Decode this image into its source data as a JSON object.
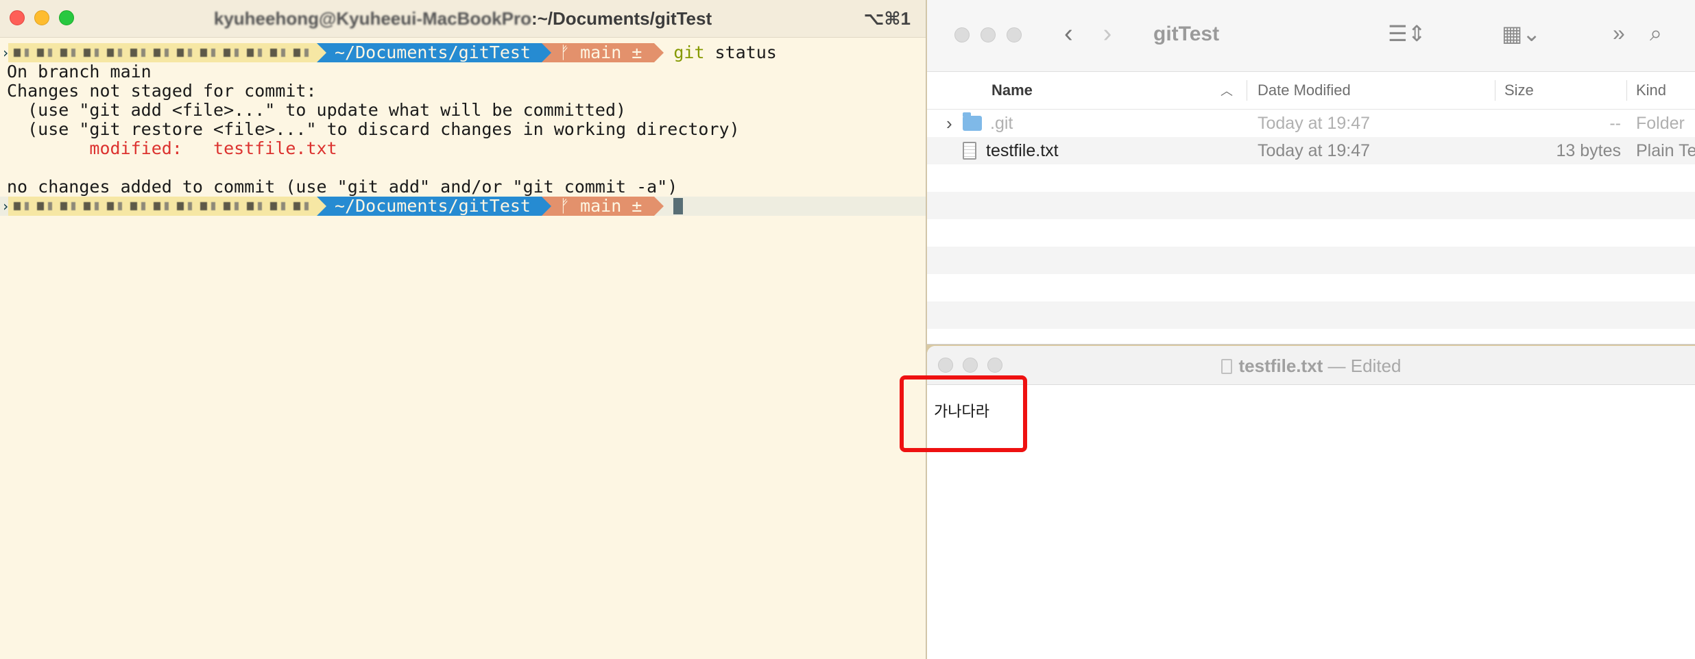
{
  "terminal": {
    "title_user": "kyuheehong@Kyuheeui-MacBookPro",
    "title_path": "~/Documents/gitTest",
    "shortcut": "⌥⌘1",
    "prompt_path": "~/Documents/gitTest",
    "prompt_branch": "ᚠ main ±",
    "command_git": "git",
    "command_args": " status",
    "output": [
      "On branch main",
      "Changes not staged for commit:",
      "  (use \"git add <file>...\" to update what will be committed)",
      "  (use \"git restore <file>...\" to discard changes in working directory)"
    ],
    "modified_label": "        modified:   testfile.txt",
    "no_changes": "no changes added to commit (use \"git add\" and/or \"git commit -a\")"
  },
  "finder": {
    "title": "gitTest",
    "columns": {
      "name": "Name",
      "date": "Date Modified",
      "size": "Size",
      "kind": "Kind"
    },
    "rows": [
      {
        "name": ".git",
        "date": "Today at 19:47",
        "size": "--",
        "kind": "Folder"
      },
      {
        "name": "testfile.txt",
        "date": "Today at 19:47",
        "size": "13 bytes",
        "kind": "Plain Te"
      }
    ]
  },
  "textedit": {
    "filename": "testfile.txt",
    "separator": " — ",
    "status": "Edited",
    "content": "가나다라"
  },
  "colors": {
    "terminal_bg": "#fdf6e3",
    "prompt_path_bg": "#268bd2",
    "prompt_branch_bg": "#e3916c",
    "git_green": "#859900",
    "modified_red": "#dc322f",
    "annotation_red": "#ee1111"
  }
}
